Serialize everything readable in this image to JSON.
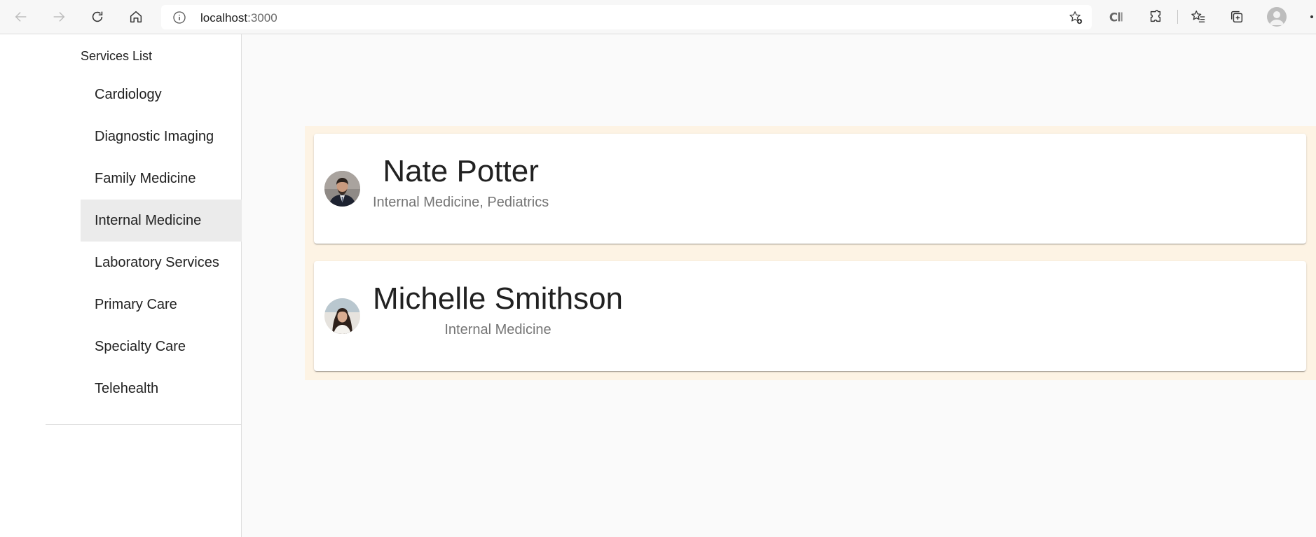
{
  "browser": {
    "url_host": "localhost",
    "url_port": ":3000",
    "icons": {
      "back": "arrow-left-icon",
      "forward": "arrow-right-icon",
      "refresh": "refresh-icon",
      "home": "home-icon",
      "site_info": "info-icon",
      "add_favorite": "star-add-icon",
      "reading_view": "reading-view-icon",
      "extensions": "puzzle-icon",
      "favorites": "favorites-icon",
      "collections": "collections-icon",
      "profile": "profile-icon"
    }
  },
  "sidebar": {
    "title": "Services List",
    "items": [
      {
        "label": "Cardiology"
      },
      {
        "label": "Diagnostic Imaging"
      },
      {
        "label": "Family Medicine"
      },
      {
        "label": "Internal Medicine",
        "selected": true
      },
      {
        "label": "Laboratory Services"
      },
      {
        "label": "Primary Care"
      },
      {
        "label": "Specialty Care"
      },
      {
        "label": "Telehealth"
      }
    ]
  },
  "doctors": [
    {
      "name": "Nate Potter",
      "specialties": "Internal Medicine, Pediatrics",
      "avatar": "doctor-photo-male"
    },
    {
      "name": "Michelle Smithson",
      "specialties": "Internal Medicine",
      "avatar": "doctor-photo-female"
    }
  ],
  "colors": {
    "panel_background": "#fdf3e4",
    "selected_item": "#ebebeb",
    "secondary_text": "#757575"
  }
}
